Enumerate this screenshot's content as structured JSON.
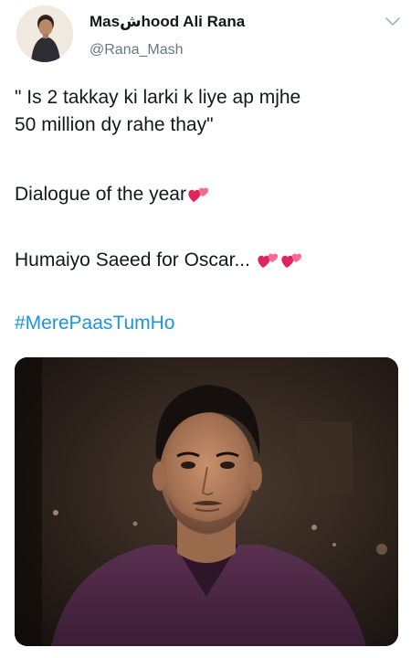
{
  "tweet": {
    "display_name": "Masشhood Ali Rana",
    "handle": "@Rana_Mash",
    "lines": [
      "\" Is 2 takkay ki larki k liye ap mjhe",
      "50 million dy rahe thay\"",
      "Dialogue of the year",
      "Humaiyo Saeed for Oscar..."
    ],
    "hashtag": "#MerePaasTumHo",
    "emoji": "two-hearts-icon",
    "media": "photo-of-man-in-purple-shirt"
  },
  "colors": {
    "text": "#14171a",
    "secondary": "#657786",
    "link": "#1b95e0",
    "heart": "#e0245e"
  }
}
